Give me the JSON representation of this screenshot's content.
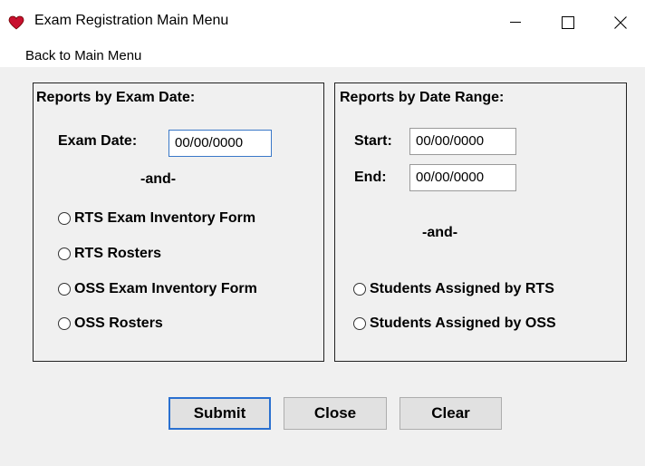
{
  "window": {
    "title": "Exam Registration Main Menu",
    "app_icon": "heart-icon",
    "controls": [
      "minimize-icon",
      "maximize-icon",
      "close-icon"
    ],
    "accent_color": "#c8102e"
  },
  "menubar": {
    "items": [
      {
        "label": "Back to Main Menu"
      }
    ]
  },
  "exam_date_group": {
    "title": "Reports by Exam Date:",
    "exam_date_label": "Exam Date:",
    "exam_date_value": "00/00/0000",
    "and_label": "-and-",
    "options": [
      {
        "label": "RTS Exam Inventory Form",
        "checked": false
      },
      {
        "label": "RTS Rosters",
        "checked": false
      },
      {
        "label": "OSS Exam Inventory Form",
        "checked": false
      },
      {
        "label": "OSS Rosters",
        "checked": false
      }
    ]
  },
  "date_range_group": {
    "title": "Reports by Date Range:",
    "start_label": "Start:",
    "start_value": "00/00/0000",
    "end_label": "End:",
    "end_value": "00/00/0000",
    "and_label": "-and-",
    "options": [
      {
        "label": "Students Assigned by RTS",
        "checked": false
      },
      {
        "label": "Students Assigned by OSS",
        "checked": false
      }
    ]
  },
  "buttons": {
    "submit": "Submit",
    "close": "Close",
    "clear": "Clear"
  }
}
